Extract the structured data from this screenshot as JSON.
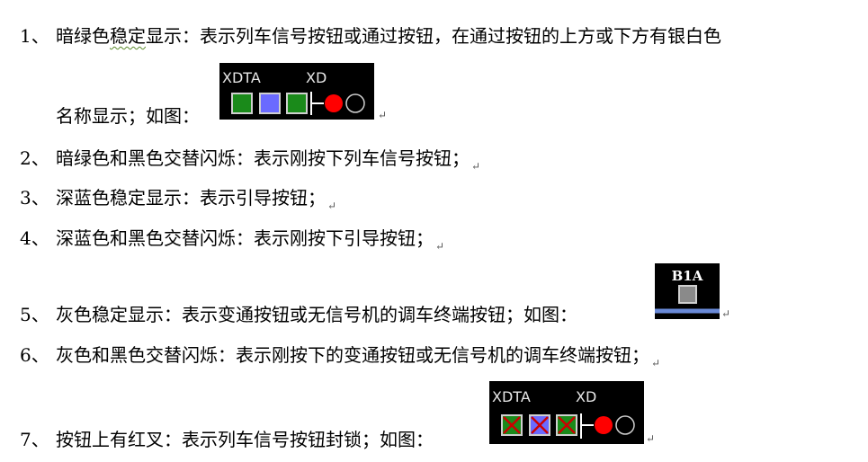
{
  "items": [
    {
      "num": "1、",
      "pre": "暗绿色",
      "squig": "稳定",
      "post": "显示：表示列车信号按钮或通过按钮，在通过按钮的上方或下方有银白色"
    },
    {
      "cont": "名称显示；如图："
    },
    {
      "num": "2、",
      "text": "暗绿色和黑色交替闪烁：表示刚按下列车信号按钮；"
    },
    {
      "num": "3、",
      "text": "深蓝色稳定显示：表示引导按钮；"
    },
    {
      "num": "4、",
      "text": "深蓝色和黑色交替闪烁：表示刚按下引导按钮；"
    },
    {
      "num": "5、",
      "text": "灰色稳定显示：表示变通按钮或无信号机的调车终端按钮；如图："
    },
    {
      "num": "6、",
      "text": "灰色和黑色交替闪烁：表示刚按下的变通按钮或无信号机的调车终端按钮；"
    },
    {
      "num": "7、",
      "text": "按钮上有红叉：表示列车信号按钮封锁；如图："
    }
  ],
  "figures": {
    "fig1": {
      "label_left": "XDTA",
      "label_right": "XD"
    },
    "fig2": {
      "label": "B1A"
    },
    "fig3": {
      "label_left": "XDTA",
      "label_right": "XD"
    }
  },
  "colors": {
    "green": "#1a8a1a",
    "blue": "#6a6aff",
    "red": "#ff0000",
    "gray": "#8a8a8a",
    "line_blue": "#6a8ad8",
    "cross": "#cc0000"
  },
  "para_mark": "↵"
}
